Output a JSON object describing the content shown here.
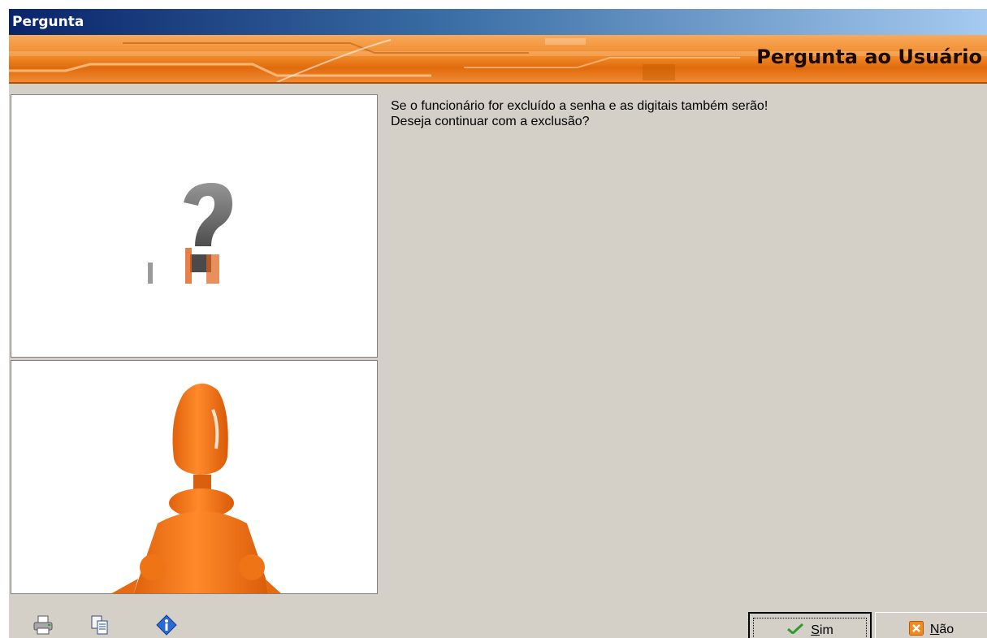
{
  "window": {
    "title": "Pergunta"
  },
  "banner": {
    "title": "Pergunta ao Usuário"
  },
  "message": {
    "line1": "Se o funcionário for excluído a senha e as digitais também serão!",
    "line2": "Deseja continuar com a exclusão?"
  },
  "toolbar": {
    "icons": [
      "printer-icon",
      "copy-icon",
      "info-icon"
    ]
  },
  "buttons": {
    "yes_label": "Sim",
    "no_label": "Não",
    "yes_icon": "checkmark-icon",
    "no_icon": "close-icon"
  },
  "colors": {
    "titlebar_start": "#0a246a",
    "titlebar_end": "#a6caf0",
    "banner_orange": "#f18a2a",
    "dialog_bg": "#d4d0c8",
    "figure_orange": "#f07a1a"
  }
}
